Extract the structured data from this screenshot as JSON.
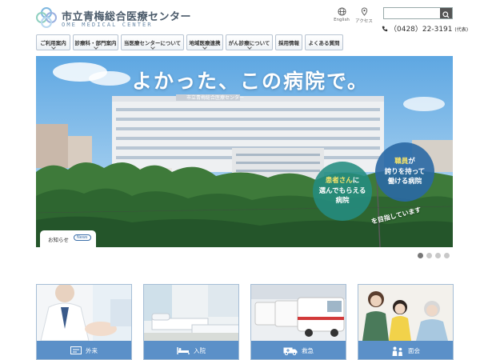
{
  "header": {
    "logo_title": "市立青梅総合医療センター",
    "logo_subtitle": "OME MEDICAL CENTER",
    "logo_icon": "ome-medical-logo",
    "utilities": [
      {
        "label": "English",
        "icon": "globe-icon"
      },
      {
        "label": "アクセス",
        "icon": "map-pin-icon"
      }
    ],
    "search": {
      "placeholder": "",
      "icon": "search-icon"
    },
    "phone": {
      "number": "（0428）22-3191",
      "note": "(代表)",
      "icon": "phone-icon"
    }
  },
  "nav": {
    "items": [
      {
        "label": "ご利用案内"
      },
      {
        "label": "診療科・部門案内"
      },
      {
        "label": "当医療センターについて"
      },
      {
        "label": "地域医療連携"
      },
      {
        "label": "がん診療について"
      },
      {
        "label": "採用情報"
      },
      {
        "label": "よくある質問"
      }
    ]
  },
  "hero": {
    "headline": "よかった、この病院で。",
    "bubble_green_lines": [
      "患者さんに",
      "選んでもらえる",
      "病院"
    ],
    "bubble_blue_lines": [
      "職員が",
      "誇りを持って",
      "働ける病院"
    ],
    "tagline": "を目指しています",
    "building_sign": "市立青梅総合医療センター",
    "notice_label": "お知らせ",
    "notice_badge": "News"
  },
  "carousel": {
    "total": 4,
    "active_index": 0
  },
  "cards": [
    {
      "label": "外来",
      "icon": "outpatient-icon"
    },
    {
      "label": "入院",
      "icon": "bed-icon"
    },
    {
      "label": "救急",
      "icon": "ambulance-icon"
    },
    {
      "label": "面会",
      "icon": "visitor-icon"
    }
  ],
  "colors": {
    "accent": "#5b90c8",
    "bubble_green": "#248c80",
    "bubble_blue": "#2a68a4",
    "highlight": "#f7e46a"
  }
}
